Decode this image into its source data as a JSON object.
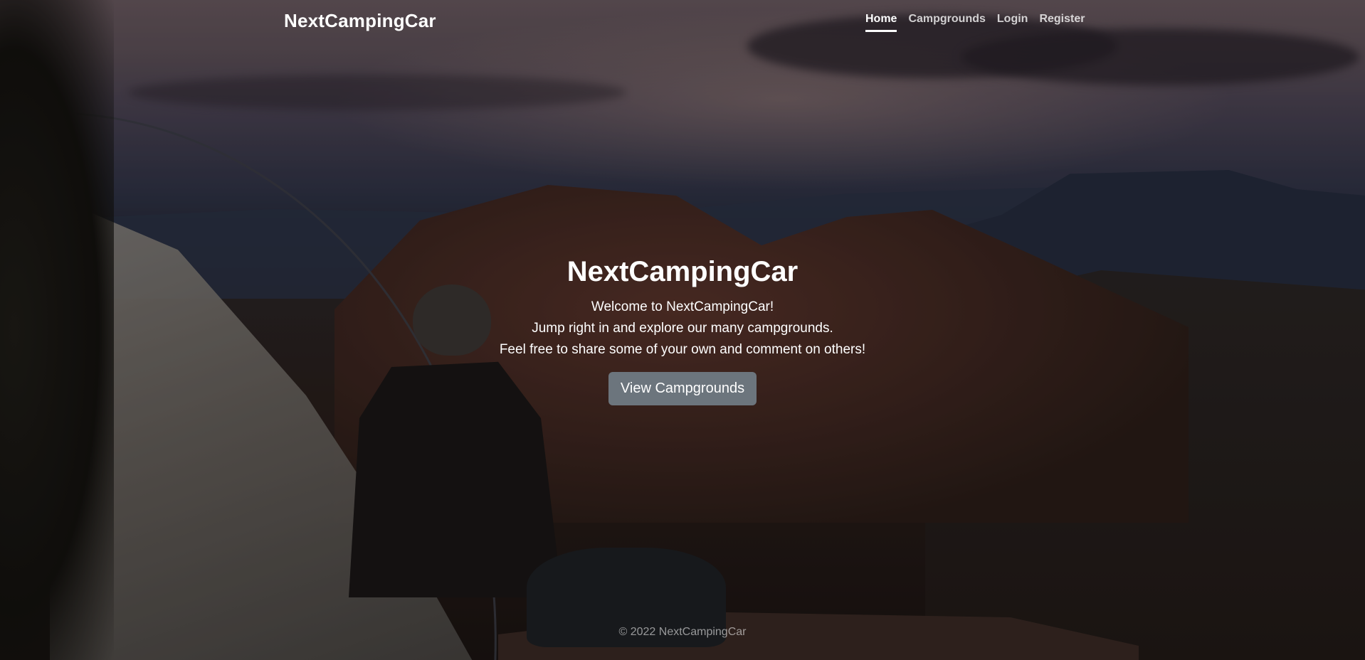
{
  "nav": {
    "brand": "NextCampingCar",
    "links": [
      {
        "label": "Home",
        "active": true
      },
      {
        "label": "Campgrounds",
        "active": false
      },
      {
        "label": "Login",
        "active": false
      },
      {
        "label": "Register",
        "active": false
      }
    ]
  },
  "hero": {
    "title": "NextCampingCar",
    "lines": [
      "Welcome to NextCampingCar!",
      "Jump right in and explore our many campgrounds.",
      "Feel free to share some of your own and comment on others!"
    ],
    "button_label": "View Campgrounds"
  },
  "footer": {
    "text": "© 2022 NextCampingCar"
  },
  "colors": {
    "button_bg": "#6c757d",
    "text": "#ffffff"
  }
}
